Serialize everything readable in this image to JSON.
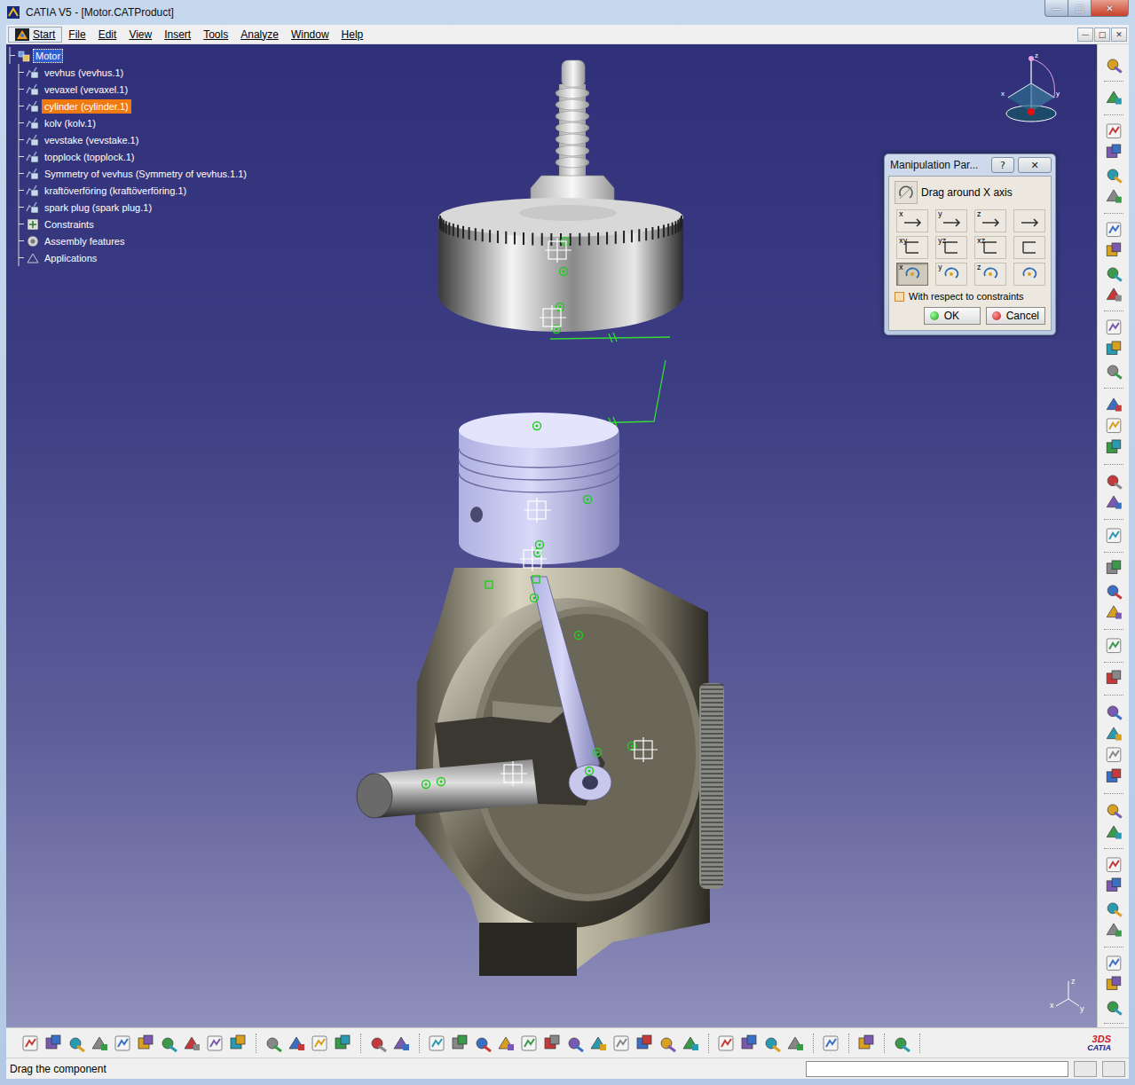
{
  "window": {
    "title": "CATIA V5 - [Motor.CATProduct]",
    "controls": [
      "—",
      "□",
      "✕"
    ]
  },
  "menu": [
    {
      "label": "Start",
      "kind": "start"
    },
    {
      "label": "File",
      "kind": "menu"
    },
    {
      "label": "Edit",
      "kind": "menu"
    },
    {
      "label": "View",
      "kind": "menu"
    },
    {
      "label": "Insert",
      "kind": "menu"
    },
    {
      "label": "Tools",
      "kind": "menu"
    },
    {
      "label": "Analyze",
      "kind": "menu"
    },
    {
      "label": "Window",
      "kind": "menu"
    },
    {
      "label": "Help",
      "kind": "menu"
    }
  ],
  "document_controls": [
    "—",
    "□",
    "✕"
  ],
  "tree": {
    "items": [
      {
        "label": "Motor",
        "kind": "product",
        "active": true,
        "selected": false
      },
      {
        "label": "vevhus (vevhus.1)",
        "kind": "component",
        "active": false,
        "selected": false
      },
      {
        "label": "vevaxel (vevaxel.1)",
        "kind": "component",
        "active": false,
        "selected": false
      },
      {
        "label": "cylinder (cylinder.1)",
        "kind": "component",
        "active": false,
        "selected": true
      },
      {
        "label": "kolv (kolv.1)",
        "kind": "component",
        "active": false,
        "selected": false
      },
      {
        "label": "vevstake (vevstake.1)",
        "kind": "component",
        "active": false,
        "selected": false
      },
      {
        "label": "topplock (topplock.1)",
        "kind": "component",
        "active": false,
        "selected": false
      },
      {
        "label": "Symmetry of vevhus (Symmetry of vevhus.1.1)",
        "kind": "component",
        "active": false,
        "selected": false
      },
      {
        "label": "kraftöverföring (kraftöverföring.1)",
        "kind": "component",
        "active": false,
        "selected": false
      },
      {
        "label": "spark plug (spark plug.1)",
        "kind": "component",
        "active": false,
        "selected": false
      },
      {
        "label": "Constraints",
        "kind": "constraints",
        "active": false,
        "selected": false
      },
      {
        "label": "Assembly features",
        "kind": "features",
        "active": false,
        "selected": false
      },
      {
        "label": "Applications",
        "kind": "applications",
        "active": false,
        "selected": false
      }
    ]
  },
  "dialog": {
    "title": "Manipulation Par...",
    "help": "?",
    "close": "✕",
    "mode": "Drag around X axis",
    "buttons": [
      {
        "label": "x",
        "selected": false
      },
      {
        "label": "y",
        "selected": false
      },
      {
        "label": "z",
        "selected": false
      },
      {
        "label": "",
        "selected": false
      },
      {
        "label": "xy",
        "selected": false
      },
      {
        "label": "yz",
        "selected": false
      },
      {
        "label": "xz",
        "selected": false
      },
      {
        "label": "",
        "selected": false
      },
      {
        "label": "x",
        "selected": true
      },
      {
        "label": "y",
        "selected": false
      },
      {
        "label": "z",
        "selected": false
      },
      {
        "label": "",
        "selected": false
      }
    ],
    "checkbox": {
      "label": "With respect to constraints",
      "checked": false
    },
    "actions": [
      {
        "label": "OK",
        "kind": "ok"
      },
      {
        "label": "Cancel",
        "kind": "cancel"
      }
    ]
  },
  "compass": {
    "labels": [
      "x",
      "y",
      "z"
    ]
  },
  "axes": {
    "labels": [
      "z",
      "x",
      "y"
    ]
  },
  "logo": {
    "brand": "3DS",
    "product": "CATIA"
  },
  "status_bar": {
    "text": "Drag the component"
  }
}
